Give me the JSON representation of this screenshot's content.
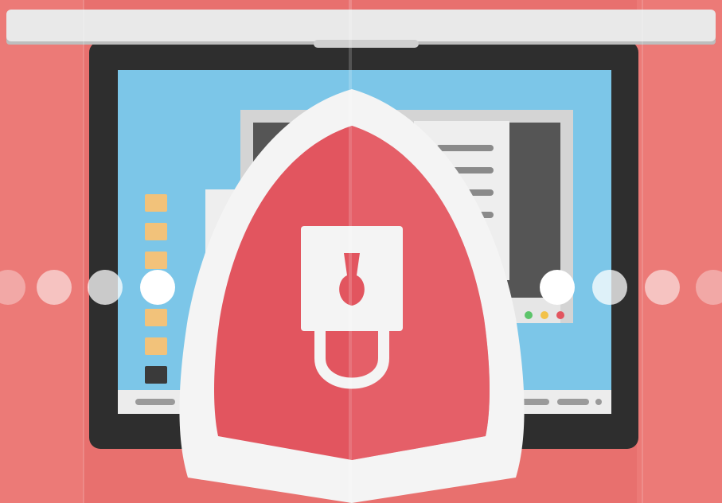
{
  "colors": {
    "background": "#e8706e",
    "background_light": "#ee8a87",
    "shelf": "#e9e9e9",
    "shelf_shadow": "#bdbdbd",
    "bezel": "#2e2e2e",
    "screen": "#7cc6e8",
    "window_frame": "#d4d4d4",
    "window_dark": "#555555",
    "window_line": "#8a8a8a",
    "folder": "#f2c27a",
    "shield_outer": "#f4f4f4",
    "shield_inner": "#e2555f",
    "lock_body": "#f4f4f4",
    "lock_keyhole": "#e2555f",
    "dot": "#ffffff",
    "status_green": "#5cc46a",
    "status_yellow": "#f2c24a",
    "status_red": "#e2555f"
  },
  "illustration": {
    "subject": "shield-with-padlock",
    "icons": [
      "shield-icon",
      "padlock-icon",
      "folder-icon",
      "window-icon"
    ],
    "dots_count": 12,
    "folders_count": 7
  }
}
